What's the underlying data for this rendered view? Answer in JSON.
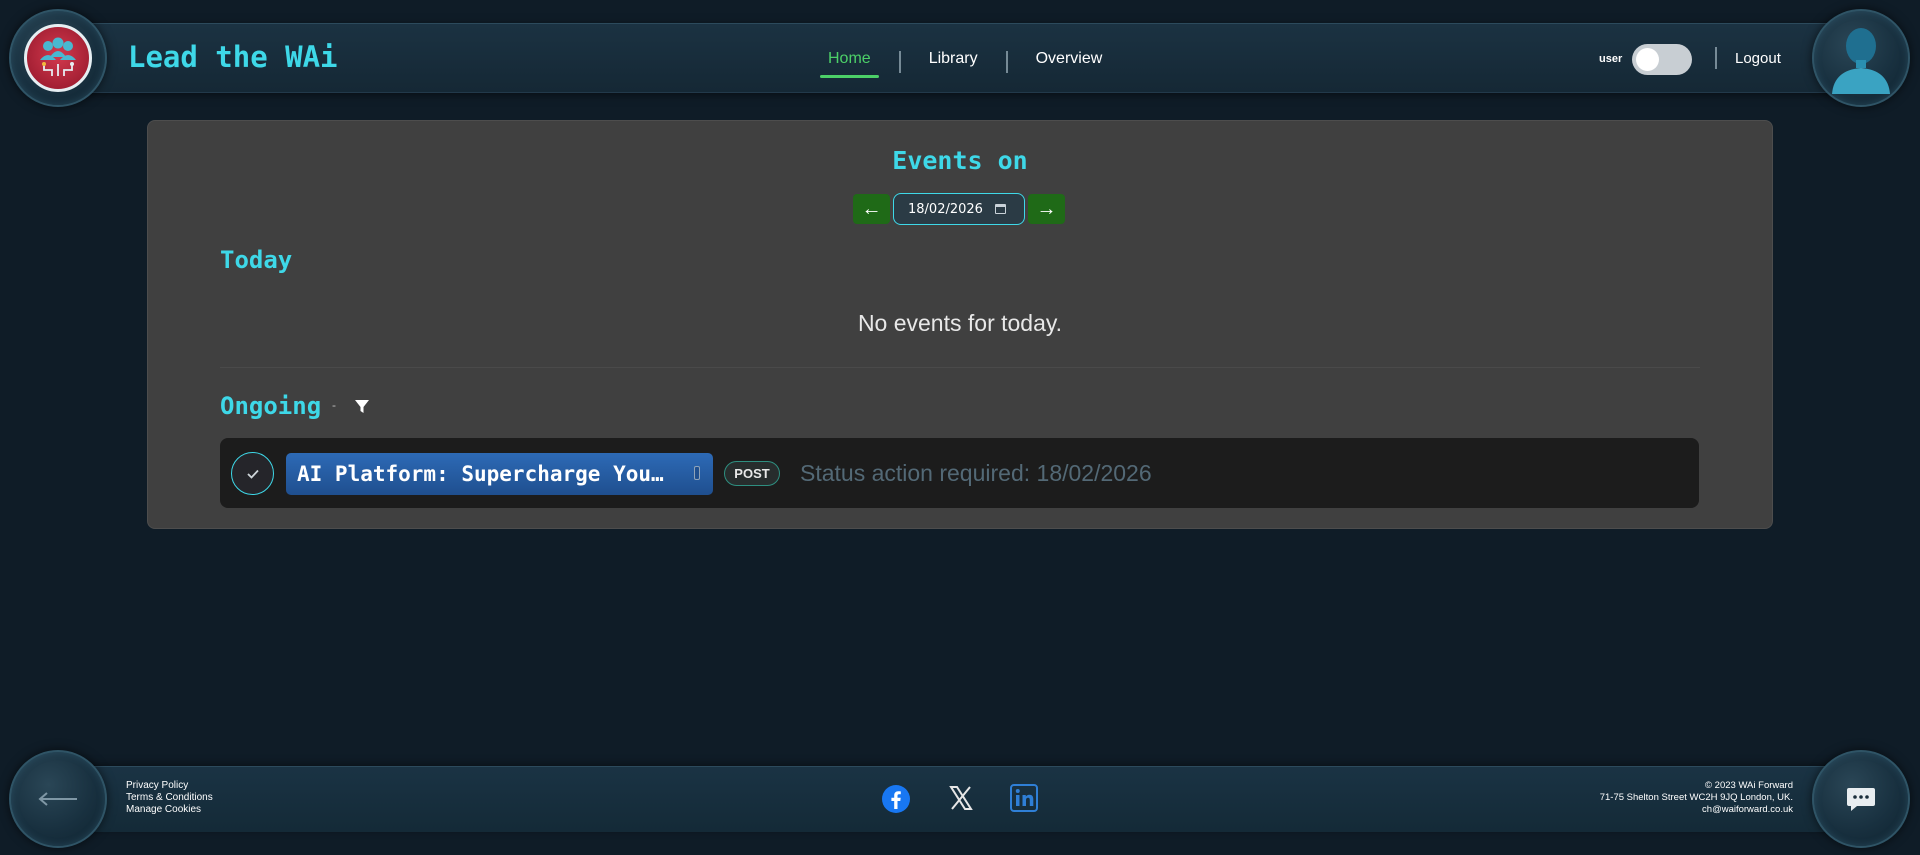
{
  "header": {
    "app_title": "Lead the WAi",
    "nav": [
      {
        "label": "Home",
        "active": true
      },
      {
        "label": "Library",
        "active": false
      },
      {
        "label": "Overview",
        "active": false
      }
    ],
    "role_label": "user",
    "role_toggle_on": false,
    "logout_label": "Logout"
  },
  "main": {
    "title": "Events on",
    "date_value": "18/02/2026",
    "prev_arrow": "←",
    "next_arrow": "→",
    "today": {
      "title": "Today",
      "empty_message": "No events for today."
    },
    "ongoing": {
      "title": "Ongoing",
      "separator": "-",
      "events": [
        {
          "name": "AI Platform: Supercharge You…",
          "type_badge": "POST",
          "status": "Status action required: 18/02/2026"
        }
      ]
    }
  },
  "footer": {
    "links": [
      "Privacy Policy",
      "Terms & Conditions",
      "Manage Cookies"
    ],
    "copyright": "© 2023 WAi Forward",
    "address": "71-75 Shelton Street WC2H 9JQ London, UK.",
    "email": "ch@waiforward.co.uk"
  },
  "colors": {
    "accent": "#3ed8e8",
    "active_nav": "#4cd068",
    "arrow_button": "#1f6a17",
    "event_name_bg": "#2d6ab6"
  },
  "icons": [
    "logo-icon",
    "user-avatar-icon",
    "filter-icon",
    "check-icon",
    "back-arrow-icon",
    "chat-icon",
    "facebook-icon",
    "x-icon",
    "linkedin-icon",
    "calendar-icon"
  ]
}
